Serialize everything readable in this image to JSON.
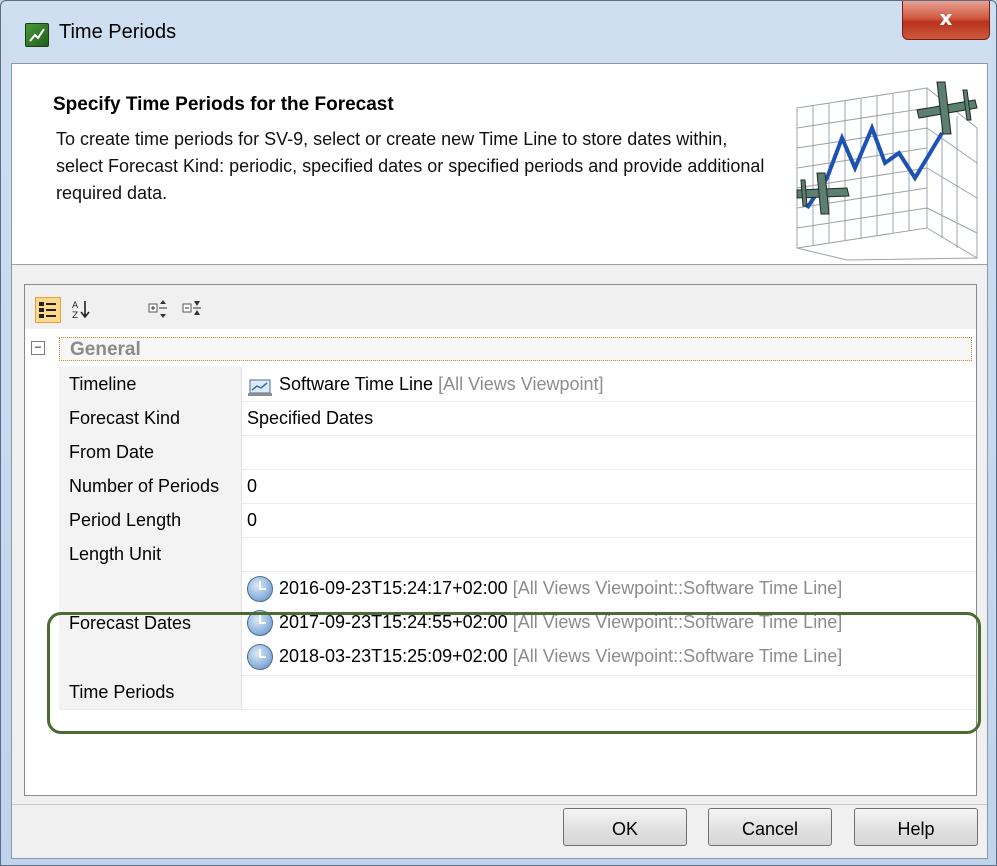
{
  "window": {
    "title": "Time Periods",
    "close_label": "x"
  },
  "header": {
    "title": "Specify Time Periods for the Forecast",
    "description": "To create time periods for SV-9, select or create new Time Line to store dates within, select Forecast Kind: periodic, specified dates or specified periods and provide additional required data."
  },
  "toolbar": {
    "tools": [
      "categorized-view-icon",
      "sort-alphabetically-icon",
      "expand-all-icon",
      "collapse-all-icon"
    ]
  },
  "group": {
    "expander": "−",
    "label": "General"
  },
  "properties": {
    "timeline": {
      "name": "Timeline",
      "value": "Software Time Line",
      "context": "[All Views Viewpoint]"
    },
    "forecast_kind": {
      "name": "Forecast Kind",
      "value": "Specified Dates"
    },
    "from_date": {
      "name": "From Date",
      "value": ""
    },
    "number_of_periods": {
      "name": "Number of Periods",
      "value": "0"
    },
    "period_length": {
      "name": "Period Length",
      "value": "0"
    },
    "length_unit": {
      "name": "Length Unit",
      "value": ""
    },
    "forecast_dates": {
      "name": "Forecast Dates",
      "items": [
        {
          "date": "2016-09-23T15:24:17+02:00",
          "context": "[All Views Viewpoint::Software Time Line]"
        },
        {
          "date": "2017-09-23T15:24:55+02:00",
          "context": "[All Views Viewpoint::Software Time Line]"
        },
        {
          "date": "2018-03-23T15:25:09+02:00",
          "context": "[All Views Viewpoint::Software Time Line]"
        }
      ]
    },
    "time_periods": {
      "name": "Time Periods",
      "value": ""
    }
  },
  "buttons": {
    "ok": "OK",
    "cancel": "Cancel",
    "help": "Help"
  }
}
